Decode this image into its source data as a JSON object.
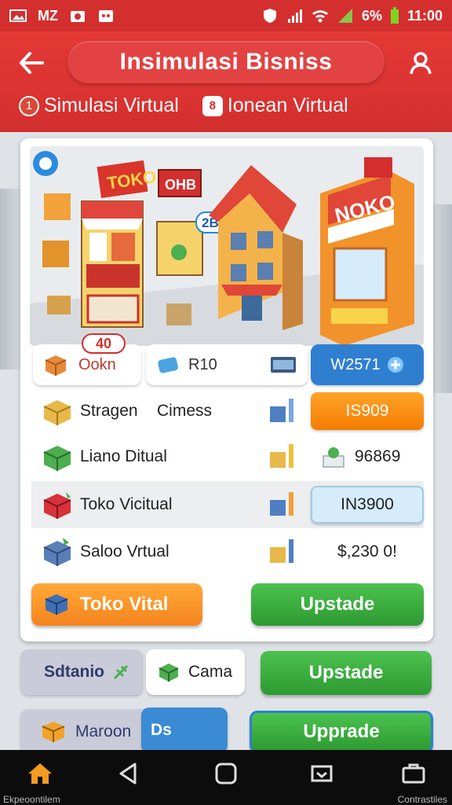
{
  "status_bar": {
    "left_icons": [
      "gallery-icon",
      "camera-icon",
      "bot-icon"
    ],
    "carrier": "MZ",
    "battery": "6%",
    "time": "11:00"
  },
  "app_bar": {
    "title": "Insimulasi Bisniss",
    "tabs": [
      {
        "badge": "1",
        "label": "Simulasi Virtual"
      },
      {
        "badge": "8",
        "label": "Ionean Virtual"
      }
    ]
  },
  "scene": {
    "sign_toko": "TOKO",
    "sign_ohb": "OHB",
    "sign_noko": "NOKO",
    "bubble": "2B→"
  },
  "stats": {
    "store_badge": "40",
    "store_label": "Ookn",
    "balance": "R10",
    "gold": "W2571"
  },
  "rows": [
    {
      "name": "Stragen",
      "sub": "Cimess",
      "value": "IS909"
    },
    {
      "name": "Liano Ditual",
      "sub": "",
      "value": "96869"
    },
    {
      "name": "Toko Vicitual",
      "sub": "",
      "value": "IN3900"
    },
    {
      "name": "Saloo Vrtual",
      "sub": "",
      "value": "$,230 0!"
    }
  ],
  "buttons": {
    "toko_virtual": "Toko Vital",
    "upgrade_1": "Upstade"
  },
  "lower": {
    "stat_label": "Sdtanio",
    "camera_label": "Cama",
    "upgrade_2": "Upstade",
    "maroon_label": "Maroon",
    "ds_label": "Ds",
    "upgrade_3": "Upprade"
  },
  "navbar": {
    "left_label": "Ekpeoontilem",
    "right_label": "Contrastiles"
  },
  "colors": {
    "primary_red": "#d32f2f",
    "orange": "#f57c00",
    "green": "#2e9a32",
    "blue": "#2f7fd0"
  }
}
